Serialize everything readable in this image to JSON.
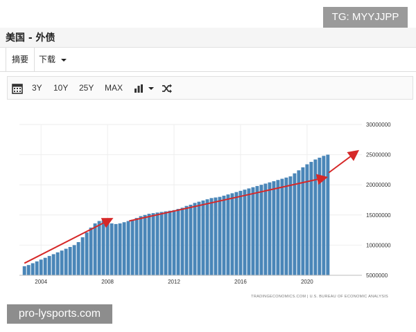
{
  "badge": {
    "text": "TG: MYYJJPP"
  },
  "header": {
    "title": "美国 - 外债"
  },
  "tabs": [
    {
      "label": "摘要"
    },
    {
      "label": "下载"
    }
  ],
  "toolbar": {
    "calendar_icon": "calendar-icon",
    "ranges": [
      "3Y",
      "10Y",
      "25Y",
      "MAX"
    ],
    "chart_type_icon": "bar-chart-icon",
    "shuffle_icon": "shuffle-icon"
  },
  "chart_data": {
    "type": "bar",
    "title": "",
    "xlabel": "",
    "ylabel": "",
    "ylim": [
      5000000,
      30000000
    ],
    "yticks": [
      "30000000",
      "25000000",
      "20000000",
      "15000000",
      "10000000",
      "5000000"
    ],
    "xticks": [
      "2004",
      "2008",
      "2012",
      "2016",
      "2020"
    ],
    "source": "TRADINGECONOMICS.COM | U.S. BUREAU OF ECONOMIC ANALYSIS",
    "bar_color": "#4a86b8",
    "arrow_color": "#d62828",
    "x_start": 2003.0,
    "x_step": 0.25,
    "values": [
      6500000,
      6700000,
      7000000,
      7300000,
      7600000,
      7900000,
      8200000,
      8500000,
      8800000,
      9100000,
      9400000,
      9700000,
      10000000,
      10500000,
      11300000,
      12100000,
      12900000,
      13600000,
      14000000,
      14100000,
      13900000,
      13600000,
      13500000,
      13600000,
      13800000,
      14000000,
      14200000,
      14500000,
      14800000,
      15000000,
      15200000,
      15300000,
      15400000,
      15500000,
      15600000,
      15700000,
      15800000,
      16000000,
      16200000,
      16500000,
      16700000,
      17000000,
      17200000,
      17400000,
      17600000,
      17800000,
      17900000,
      18000000,
      18200000,
      18400000,
      18600000,
      18800000,
      19000000,
      19200000,
      19400000,
      19600000,
      19800000,
      20000000,
      20200000,
      20400000,
      20600000,
      20800000,
      21000000,
      21200000,
      21400000,
      21900000,
      22400000,
      22900000,
      23400000,
      23800000,
      24200000,
      24500000,
      24800000,
      25000000
    ]
  }
}
